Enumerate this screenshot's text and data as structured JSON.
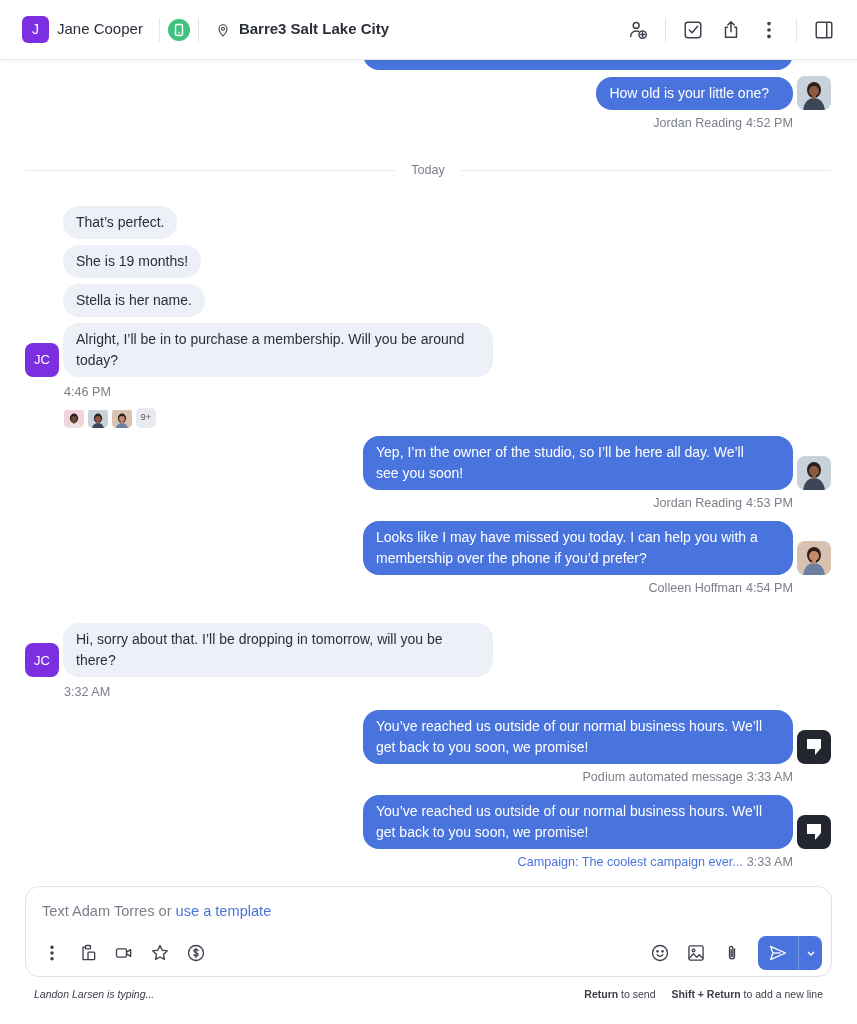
{
  "header": {
    "contact": {
      "initial": "J",
      "name": "Jane Cooper"
    },
    "location": "Barre3 Salt Lake City"
  },
  "messages": [
    {
      "kind": "truncated"
    },
    {
      "kind": "outgoing",
      "text": "How old is your little one?",
      "sender": "Jordan Reading",
      "time": "4:52 PM",
      "sender_link": false
    },
    {
      "kind": "divider",
      "label": "Today"
    },
    {
      "kind": "incoming",
      "initials": "JC",
      "bubbles": [
        "That’s perfect.",
        "She is 19 months!",
        "Stella is her name.",
        "Alright, I’ll be in to purchase a membership. Will you be around today?"
      ],
      "time": "4:46 PM",
      "more": "9+"
    },
    {
      "kind": "outgoing",
      "text": "Yep, I’m the owner of the studio, so I’ll be here all day. We’ll see you soon!",
      "sender": "Jordan Reading",
      "time": "4:53 PM",
      "sender_link": false
    },
    {
      "kind": "outgoing",
      "text": "Looks like I may have missed you today. I can help you with a membership over the phone if you’d prefer?",
      "sender": "Colleen Hoffman",
      "time": "4:54 PM",
      "sender_link": false
    },
    {
      "kind": "incoming",
      "initials": "JC",
      "bubbles": [
        "Hi, sorry about that. I’ll be dropping in tomorrow, will you be there?"
      ],
      "time": "3:32 AM"
    },
    {
      "kind": "outgoing",
      "text": "You’ve reached us outside of our normal business hours. We’ll get back to you soon, we promise!",
      "sender": "Podium automated message",
      "time": "3:33 AM",
      "avatar": {
        "kind": "bot"
      },
      "sender_link": false
    },
    {
      "kind": "outgoing",
      "text": "You’ve reached us outside of our normal business hours. We’ll get back to you soon, we promise!",
      "sender": "Campaign: The coolest campaign ever...",
      "time": "3:33 AM",
      "avatar": {
        "kind": "bot"
      },
      "sender_link": true
    }
  ],
  "composer": {
    "placeholder": "Text Adam Torres or",
    "template_link": "use a template"
  },
  "footer": {
    "typing": "Landon Larsen is typing...",
    "hints": [
      {
        "key": "Return",
        "text": "to send"
      },
      {
        "key": "Shift + Return",
        "text": "to add a new line"
      }
    ]
  }
}
